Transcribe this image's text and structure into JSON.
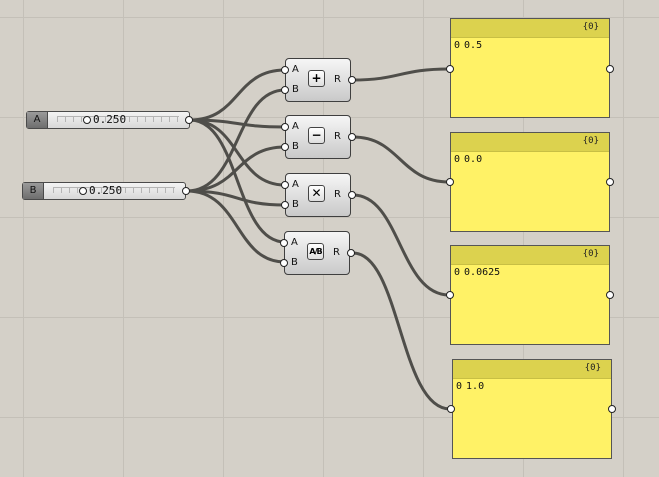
{
  "sliders": [
    {
      "name": "A",
      "value": "0.250"
    },
    {
      "name": "B",
      "value": "0.250"
    }
  ],
  "operations": [
    {
      "input_a": "A",
      "input_b": "B",
      "output": "R",
      "symbol": "+",
      "icon": "addition-icon"
    },
    {
      "input_a": "A",
      "input_b": "B",
      "output": "R",
      "symbol": "−",
      "icon": "subtraction-icon"
    },
    {
      "input_a": "A",
      "input_b": "B",
      "output": "R",
      "symbol": "✕",
      "icon": "multiplication-icon"
    },
    {
      "input_a": "A",
      "input_b": "B",
      "output": "R",
      "symbol": "A/B",
      "icon": "division-icon"
    }
  ],
  "panels": [
    {
      "path": "{0}",
      "index": "0",
      "value": "0.5"
    },
    {
      "path": "{0}",
      "index": "0",
      "value": "0.0"
    },
    {
      "path": "{0}",
      "index": "0",
      "value": "0.0625"
    },
    {
      "path": "{0}",
      "index": "0",
      "value": "1.0"
    }
  ],
  "colors": {
    "canvas": "#d4d0c8",
    "panel": "#fff266",
    "panel_header": "#dcd24e",
    "wire": "#4f4e4a"
  }
}
